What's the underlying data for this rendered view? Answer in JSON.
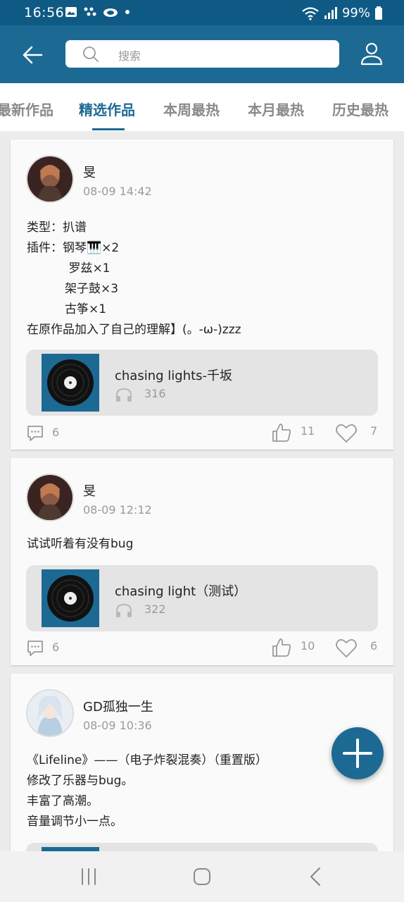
{
  "status_bar": {
    "time": "16:56",
    "battery": "99%",
    "icons": [
      "gallery-icon",
      "dots-icon",
      "cloud-icon",
      "dot-icon",
      "wifi-icon",
      "signal-icon",
      "battery-icon"
    ]
  },
  "appbar": {
    "search_placeholder": "搜索",
    "icons": [
      "back-arrow-icon",
      "search-icon",
      "user-icon"
    ]
  },
  "tabs": [
    {
      "label": "最新作品",
      "active": false
    },
    {
      "label": "精选作品",
      "active": true
    },
    {
      "label": "本周最热",
      "active": false
    },
    {
      "label": "本月最热",
      "active": false
    },
    {
      "label": "历史最热",
      "active": false
    }
  ],
  "posts": [
    {
      "author": "旻",
      "date": "08-09 14:42",
      "body": "类型：扒谱\n插件：钢琴🎹×2\n           罗兹×1\n          架子鼓×3\n          古筝×1\n在原作品加入了自己的理解】(。-ω-)zzz",
      "track_title": "chasing lights-千坂",
      "plays": "316",
      "comments": "6",
      "likes": "11",
      "favorites": "7"
    },
    {
      "author": "旻",
      "date": "08-09 12:12",
      "body": "试试听着有没有bug",
      "track_title": "chasing light（测试）",
      "plays": "322",
      "comments": "6",
      "likes": "10",
      "favorites": "6"
    },
    {
      "author": "GD孤独一生",
      "date": "08-09 10:36",
      "body": "《Lifeline》——（电子炸裂混奏）（重置版）\n修改了乐器与bug。\n丰富了高潮。\n音量调节小一点。"
    }
  ],
  "colors": {
    "primary": "#1c6a94",
    "status_bar": "#0f5a84",
    "background": "#ececec"
  }
}
